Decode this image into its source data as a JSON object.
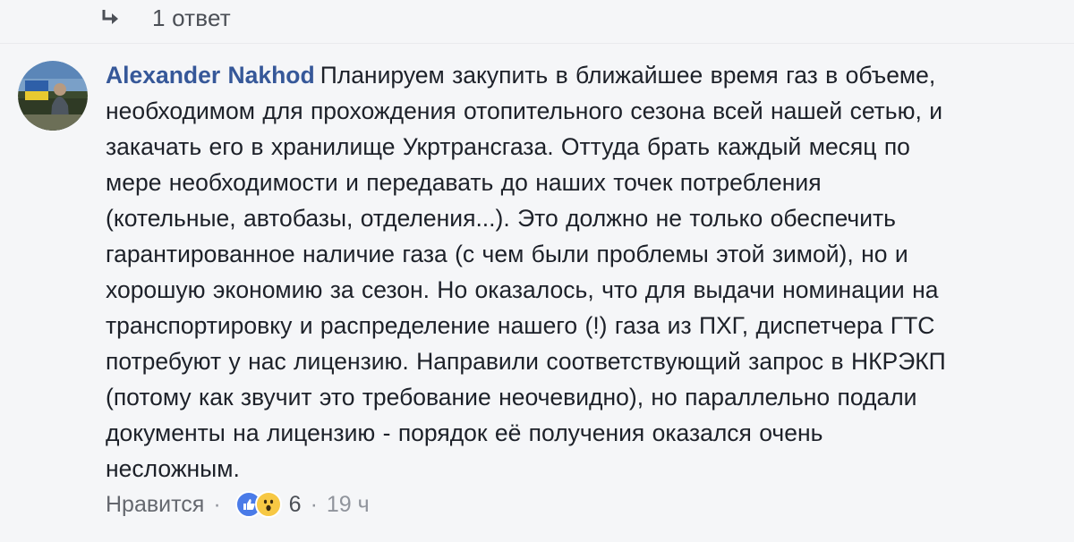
{
  "reply_row": {
    "count_label": "1 ответ",
    "icon": "reply-arrow-icon"
  },
  "comment": {
    "author": "Alexander Nakhod",
    "lines": [
      "Планируем закупить в ближайшее время газ в объеме,",
      "необходимом для прохождения отопительного сезона всей нашей сетью, и",
      "закачать его в хранилище Укртрансгаза. Оттуда брать каждый месяц по",
      "мере необходимости и передавать до наших точек потребления",
      "(котельные, автобазы, отделения...). Это должно не только обеспечить",
      "гарантированное наличие газа (с чем были проблемы этой зимой), но и",
      "хорошую экономию за сезон. Но оказалось, что для выдачи номинации на",
      "транспортировку и распределение нашего (!) газа из ПХГ, диспетчера ГТС",
      "потребуют у нас лицензию. Направили соответствующий запрос в НКРЭКП",
      "(потому как звучит это требование неочевидно), но параллельно подали",
      "документы на лицензию - порядок её получения оказался очень",
      "несложным."
    ]
  },
  "actions": {
    "like_label": "Нравится",
    "separator": "·",
    "reaction_count": "6",
    "time": "19 ч",
    "reactions": [
      "like-icon",
      "wow-icon"
    ]
  },
  "colors": {
    "author": "#365899",
    "meta": "#90949c",
    "like_reaction": "#4a7be8",
    "wow_reaction": "#f7c844"
  }
}
